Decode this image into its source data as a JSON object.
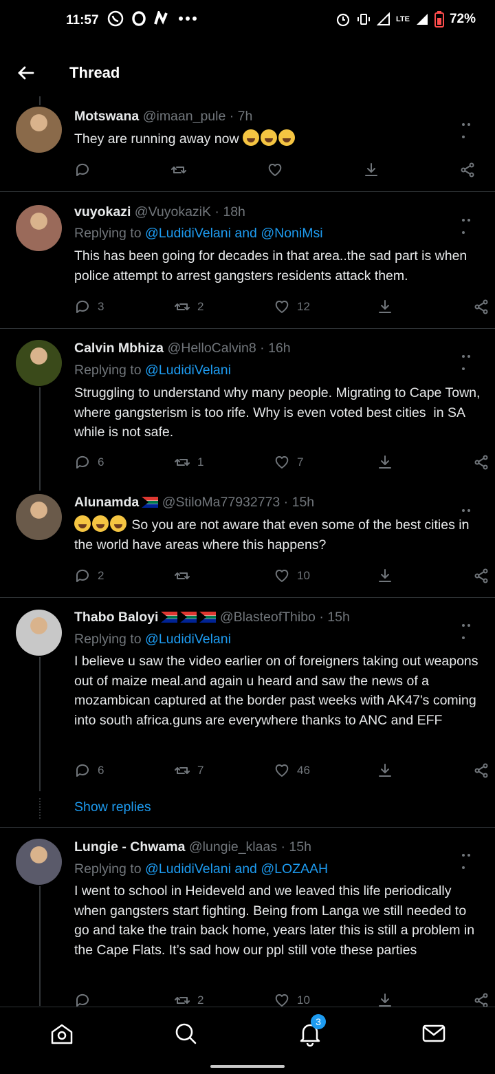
{
  "status_bar": {
    "time": "11:57",
    "battery": "72%",
    "network": "LTE"
  },
  "header": {
    "title": "Thread"
  },
  "tweets": [
    {
      "name": "Motswana",
      "handle": "@imaan_pule",
      "time": "7h",
      "text": "They are running away now",
      "replies": "",
      "retweets": "",
      "likes": ""
    },
    {
      "name": "vuyokazi",
      "handle": "@VuyokaziK",
      "time": "18h",
      "reply_prefix": "Replying to",
      "reply_mentions": "@LudidiVelani and @NoniMsi",
      "text": "This has been going for decades in that area..the sad part is when police attempt to arrest gangsters residents attack them.",
      "replies": "3",
      "retweets": "2",
      "likes": "12"
    },
    {
      "name": "Calvin Mbhiza",
      "handle": "@HelloCalvin8",
      "time": "16h",
      "reply_prefix": "Replying to",
      "reply_mentions": "@LudidiVelani",
      "text": "Struggling to understand why many people. Migrating to Cape Town, where gangsterism is too rife. Why is even voted best cities  in SA while is not safe.",
      "replies": "6",
      "retweets": "1",
      "likes": "7"
    },
    {
      "name": "Alunamda",
      "handle": "@StiloMa77932773",
      "time": "15h",
      "text": "So you are not aware that even some of the best cities in the world have areas where this happens?",
      "replies": "2",
      "retweets": "",
      "likes": "10"
    },
    {
      "name": "Thabo Baloyi",
      "handle": "@BlasteofThibo",
      "time": "15h",
      "reply_prefix": "Replying to",
      "reply_mentions": "@LudidiVelani",
      "text": "I believe u saw the video earlier on of foreigners taking out weapons out of maize meal.and again u heard and saw the news of a mozambican captured at the border past weeks with AK47's coming into south africa.guns are everywhere thanks to ANC and EFF",
      "replies": "6",
      "retweets": "7",
      "likes": "46"
    },
    {
      "name": "Lungie - Chwama",
      "handle": "@lungie_klaas",
      "time": "15h",
      "reply_prefix": "Replying to",
      "reply_mentions": "@LudidiVelani and @LOZAAH",
      "text": "I went to school in Heideveld and we leaved this life periodically when gangsters start fighting. Being from Langa we still needed to go and take the train back home, years later this is still a problem in the Cape Flats. It’s sad how our ppl still vote these parties",
      "replies": "",
      "retweets": "2",
      "likes": "10"
    }
  ],
  "show_replies": "Show replies",
  "bottom_nav": {
    "notifications_badge": "3"
  },
  "colors": {
    "accent": "#1d9bf0",
    "muted": "#71767b",
    "background": "#000000"
  },
  "icons": [
    "back-arrow-icon",
    "reply-icon",
    "retweet-icon",
    "like-icon",
    "download-icon",
    "share-icon",
    "more-icon",
    "home-icon",
    "search-icon",
    "notifications-icon",
    "messages-icon"
  ]
}
